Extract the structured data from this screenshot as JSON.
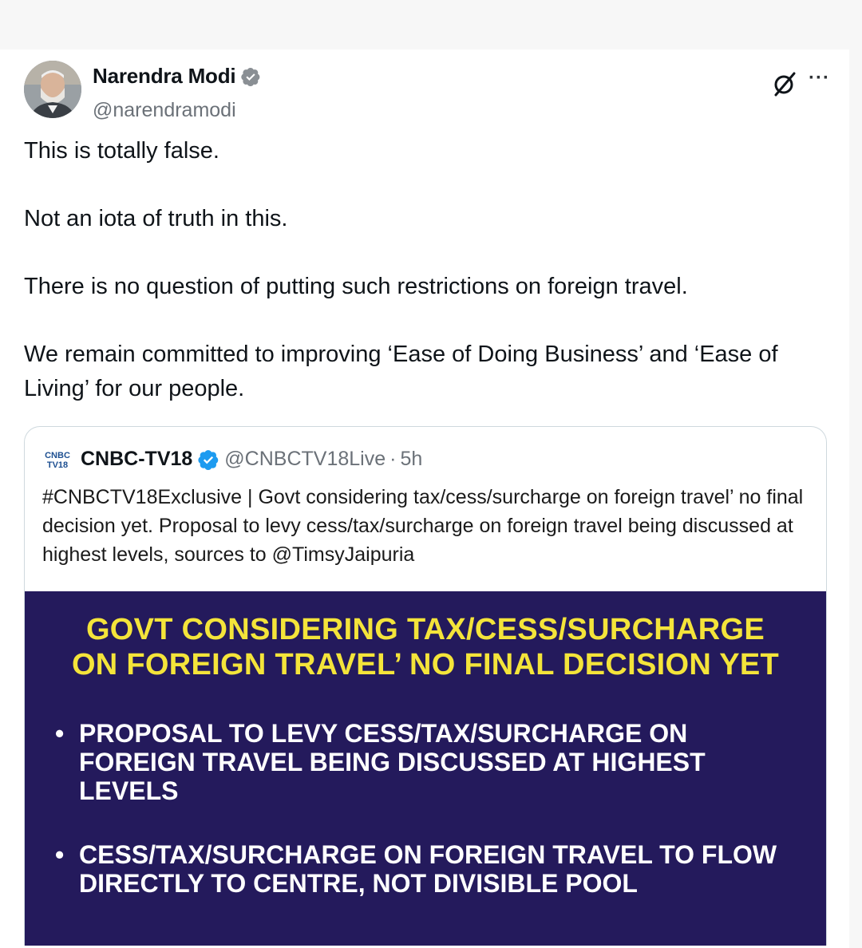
{
  "author": {
    "name": "Narendra Modi",
    "handle": "@narendramodi",
    "verified_color": "#1d9bf0"
  },
  "header_icons": {
    "grok": "grok-icon",
    "more": "···"
  },
  "tweet": {
    "paragraphs": [
      "This is totally false.",
      "Not an iota of truth in this.",
      "There is no question of putting such restrictions on foreign travel.",
      "We remain committed to improving ‘Ease of Doing Business’ and ‘Ease of Living’ for our people."
    ]
  },
  "quote": {
    "logo_text_top": "CNBC",
    "logo_text_bottom": "TV18",
    "name": "CNBC-TV18",
    "handle": "@CNBCTV18Live",
    "separator": "·",
    "time": "5h",
    "text": "#CNBCTV18Exclusive | Govt considering tax/cess/surcharge on foreign travel’ no final decision yet. Proposal to levy cess/tax/surcharge on foreign travel being discussed at highest levels, sources to @TimsyJaipuria",
    "image": {
      "background": "#241a5c",
      "headline_color": "#f4e43a",
      "headline_line1": "GOVT CONSIDERING TAX/CESS/SURCHARGE",
      "headline_line2": "ON FOREIGN TRAVEL’ NO FINAL DECISION YET",
      "bullets": [
        "PROPOSAL TO LEVY CESS/TAX/SURCHARGE ON FOREIGN TRAVEL BEING DISCUSSED AT HIGHEST LEVELS",
        "CESS/TAX/SURCHARGE ON FOREIGN TRAVEL TO FLOW DIRECTLY TO CENTRE, NOT DIVISIBLE POOL"
      ],
      "bullet_mark": "•"
    }
  }
}
